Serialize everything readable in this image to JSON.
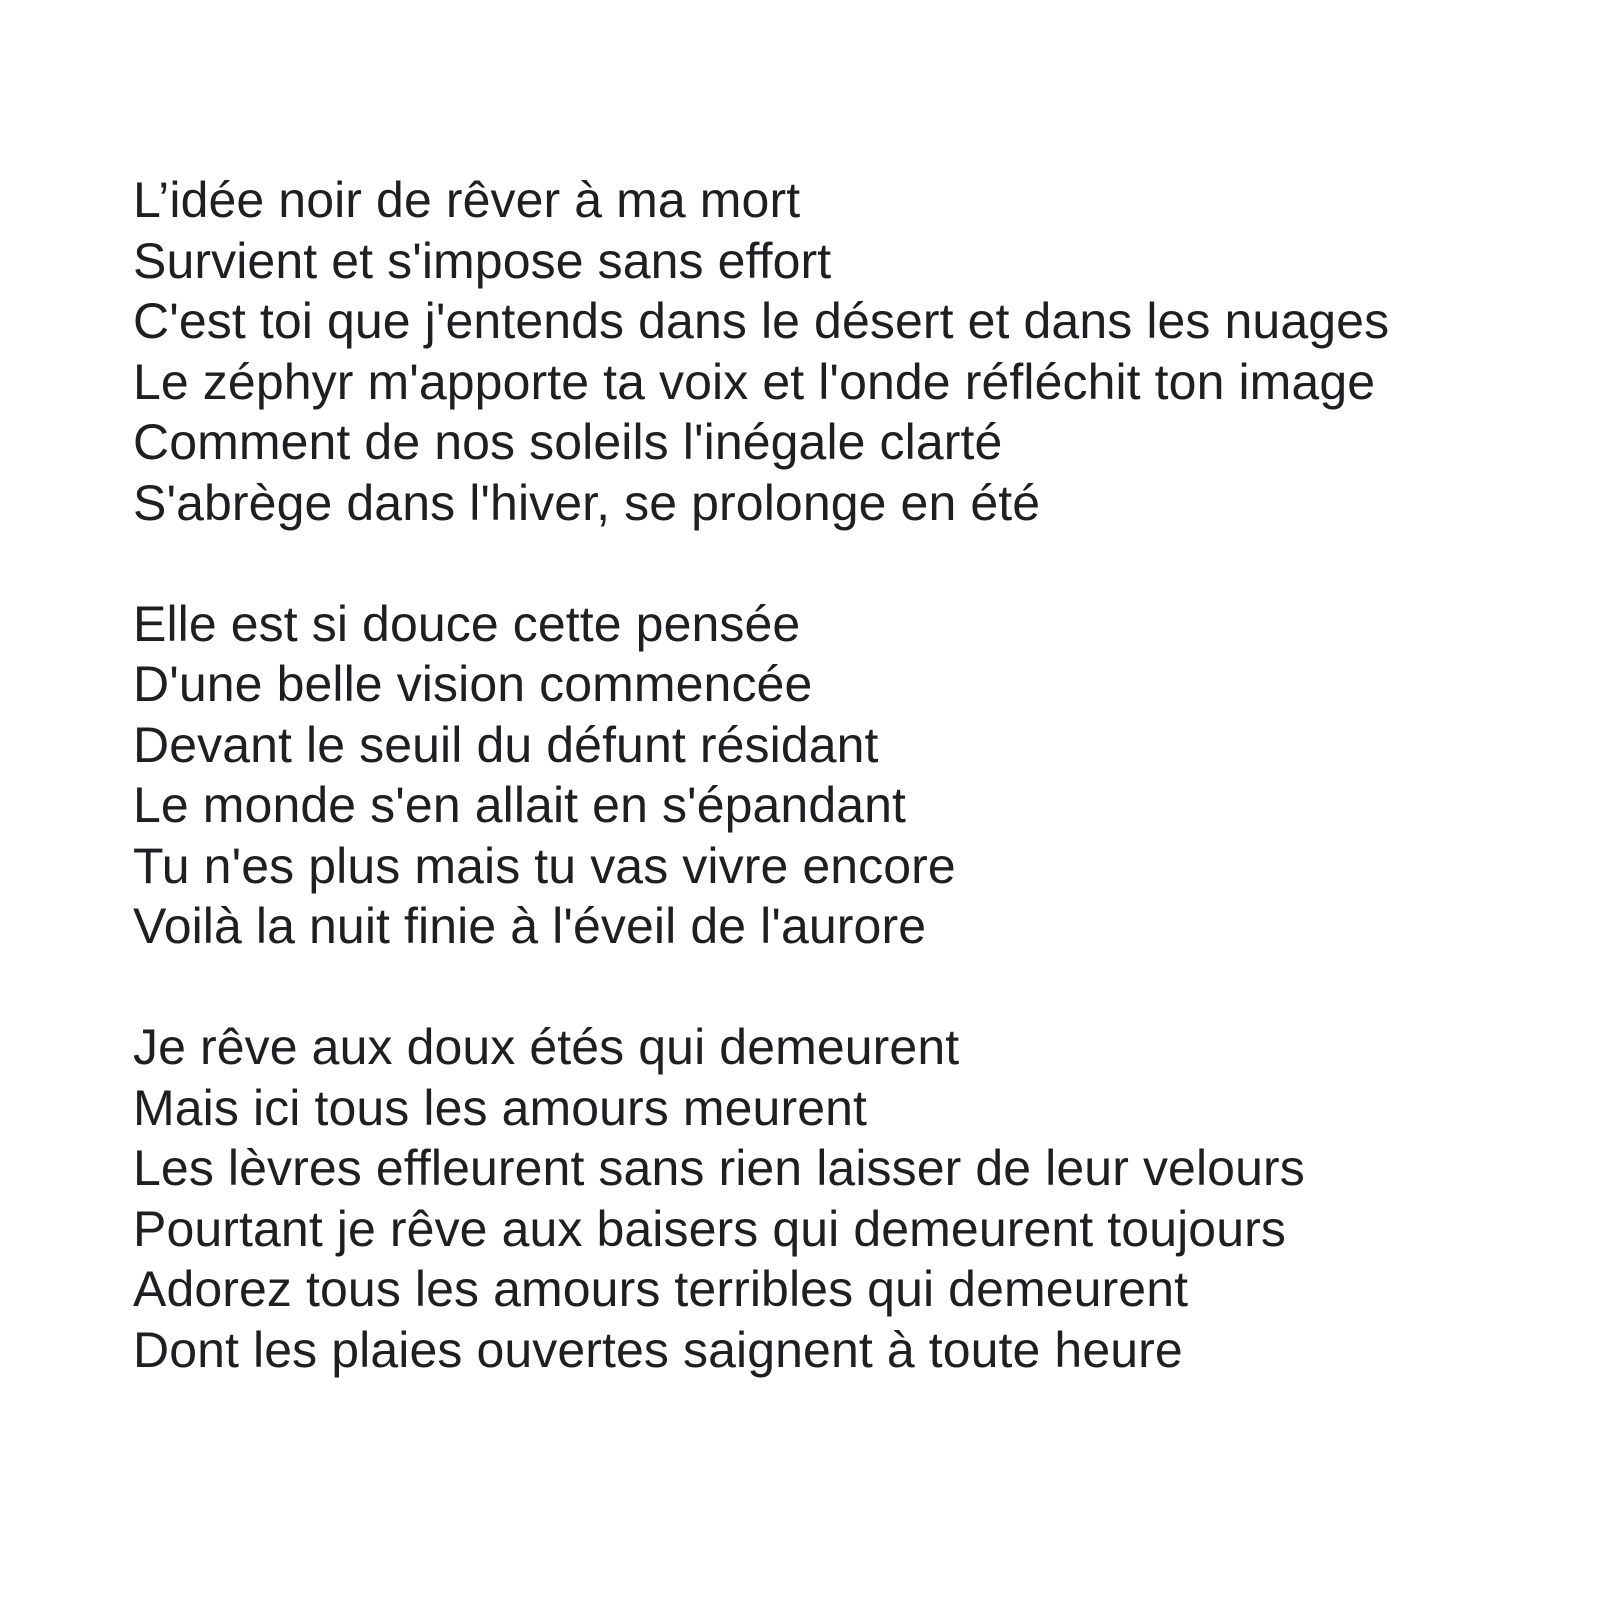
{
  "poem": {
    "stanzas": [
      {
        "lines": [
          "L’idée noir de rêver à ma mort",
          "Survient et s'impose sans effort",
          "C'est toi que j'entends dans le désert et dans les nuages",
          "Le zéphyr m'apporte ta voix et l'onde réfléchit ton image",
          "Comment de nos soleils l'inégale clarté",
          "S'abrège dans l'hiver, se prolonge en été"
        ]
      },
      {
        "lines": [
          "Elle est si douce cette pensée",
          "D'une belle vision commencée",
          "Devant le seuil du défunt résidant",
          "Le monde s'en allait en s'épandant",
          "Tu n'es plus mais tu vas vivre encore",
          "Voilà la nuit finie à l'éveil de l'aurore"
        ]
      },
      {
        "lines": [
          "Je rêve aux doux étés qui demeurent",
          "Mais ici tous les amours meurent",
          "Les lèvres effleurent sans rien laisser de leur velours",
          "Pourtant je rêve aux baisers qui demeurent toujours",
          "Adorez tous les amours terribles qui demeurent",
          "Dont les plaies ouvertes saignent à toute heure"
        ]
      }
    ]
  }
}
